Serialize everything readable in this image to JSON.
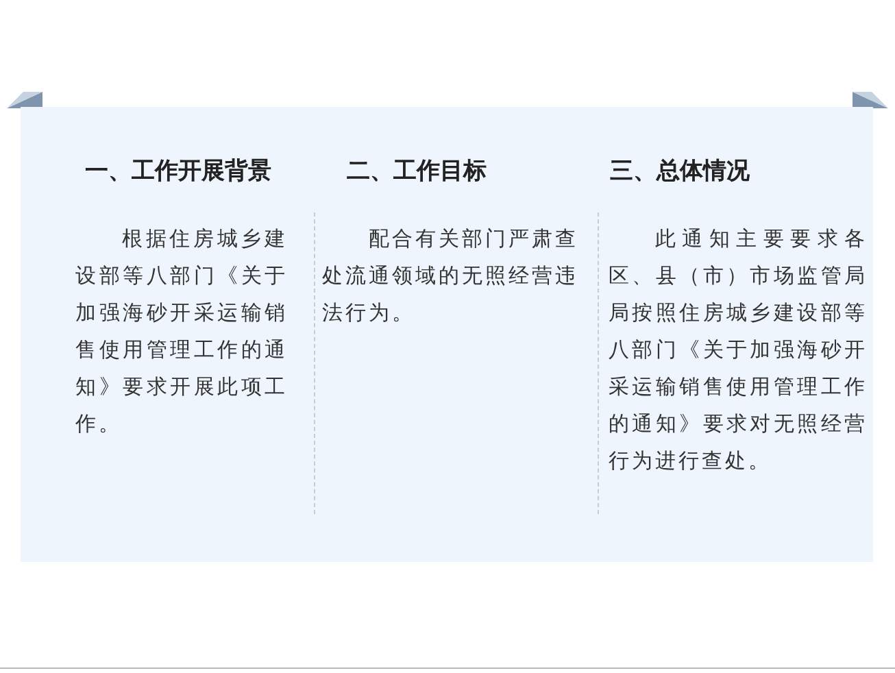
{
  "columns": [
    {
      "heading": "一、工作开展背景",
      "text": "根据住房城乡建设部等八部门《关于加强海砂开采运输销售使用管理工作的通知》要求开展此项工作。"
    },
    {
      "heading": "二、工作目标",
      "text": "配合有关部门严肃查处流通领域的无照经营违法行为。"
    },
    {
      "heading": "三、总体情况",
      "text": "此通知主要要求各区、县（市）市场监管局局按照住房城乡建设部等八部门《关于加强海砂开采运输销售使用管理工作的通知》要求对无照经营行为进行查处。"
    }
  ]
}
